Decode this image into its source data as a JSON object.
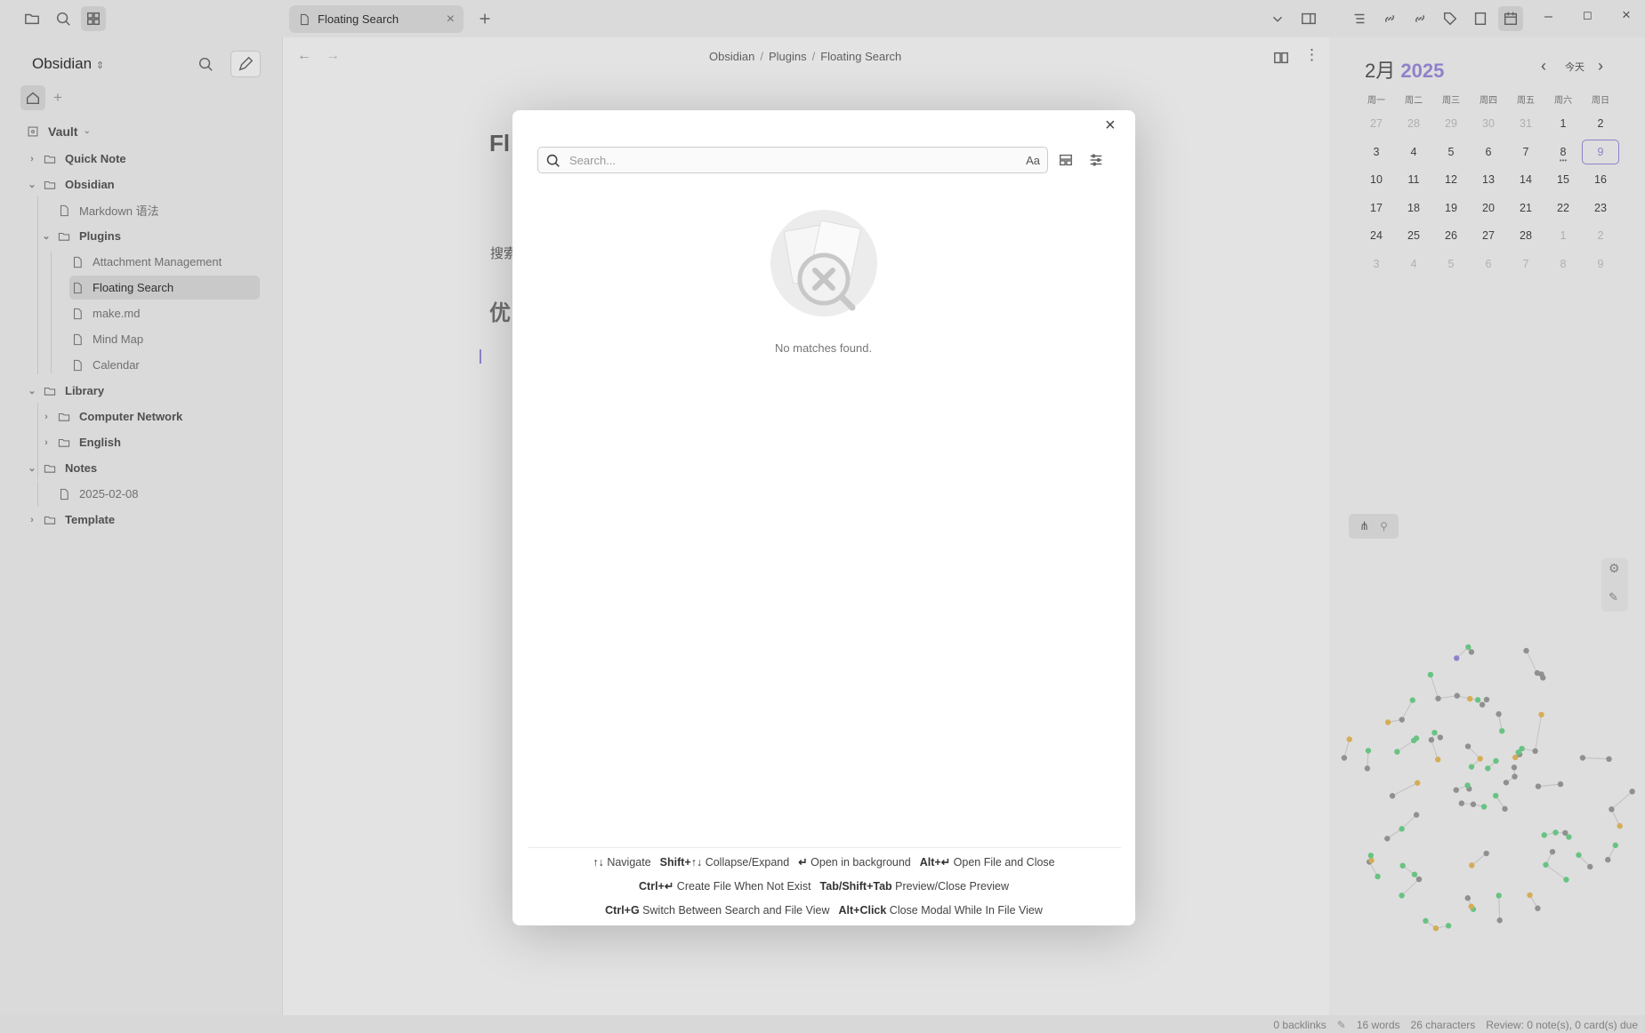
{
  "tab": {
    "title": "Floating Search"
  },
  "sidebar": {
    "vault_switcher": "Obsidian",
    "vault_root": "Vault",
    "items": [
      {
        "label": "Quick Note",
        "type": "folder"
      },
      {
        "label": "Obsidian",
        "type": "folder"
      },
      {
        "label": "Markdown 语法",
        "type": "file"
      },
      {
        "label": "Plugins",
        "type": "folder"
      },
      {
        "label": "Attachment Management",
        "type": "file"
      },
      {
        "label": "Floating Search",
        "type": "file"
      },
      {
        "label": "make.md",
        "type": "file"
      },
      {
        "label": "Mind Map",
        "type": "file"
      },
      {
        "label": "Calendar",
        "type": "file"
      },
      {
        "label": "Library",
        "type": "folder"
      },
      {
        "label": "Computer Network",
        "type": "folder"
      },
      {
        "label": "English",
        "type": "folder"
      },
      {
        "label": "Notes",
        "type": "folder"
      },
      {
        "label": "2025-02-08",
        "type": "file"
      },
      {
        "label": "Template",
        "type": "folder"
      }
    ]
  },
  "breadcrumb": [
    "Obsidian",
    "Plugins",
    "Floating Search"
  ],
  "editor_peek": {
    "title_fragment": "Fl",
    "text_fragment": "搜索",
    "heading_fragment": "优"
  },
  "modal": {
    "search_placeholder": "Search...",
    "search_value": "",
    "match_case_label": "Aa",
    "empty_message": "No matches found.",
    "hints": [
      [
        {
          "key": "↑↓",
          "label": "Navigate"
        },
        {
          "key": "Shift+↑↓",
          "label": "Collapse/Expand"
        },
        {
          "key": "↵",
          "label": "Open in background"
        },
        {
          "key": "Alt+↵",
          "label": "Open File and Close"
        }
      ],
      [
        {
          "key": "Ctrl+↵",
          "label": "Create File When Not Exist"
        },
        {
          "key": "Tab/Shift+Tab",
          "label": "Preview/Close Preview"
        }
      ],
      [
        {
          "key": "Ctrl+G",
          "label": "Switch Between Search and File View"
        },
        {
          "key": "Alt+Click",
          "label": "Close Modal While In File View"
        }
      ]
    ]
  },
  "calendar": {
    "month": "2月",
    "year": "2025",
    "today_label": "今天",
    "weekdays": [
      "周一",
      "周二",
      "周三",
      "周四",
      "周五",
      "周六",
      "周日"
    ],
    "weeks": [
      [
        "27",
        "28",
        "29",
        "30",
        "31",
        "1",
        "2"
      ],
      [
        "3",
        "4",
        "5",
        "6",
        "7",
        "8",
        "9"
      ],
      [
        "10",
        "11",
        "12",
        "13",
        "14",
        "15",
        "16"
      ],
      [
        "17",
        "18",
        "19",
        "20",
        "21",
        "22",
        "23"
      ],
      [
        "24",
        "25",
        "26",
        "27",
        "28",
        "1",
        "2"
      ],
      [
        "3",
        "4",
        "5",
        "6",
        "7",
        "8",
        "9"
      ]
    ],
    "selected_day": "9",
    "accent_color": "#9b8ad8"
  },
  "status_bar": {
    "backlinks": "0 backlinks",
    "words": "16 words",
    "characters": "26 characters",
    "review": "Review: 0 note(s), 0 card(s) due"
  }
}
